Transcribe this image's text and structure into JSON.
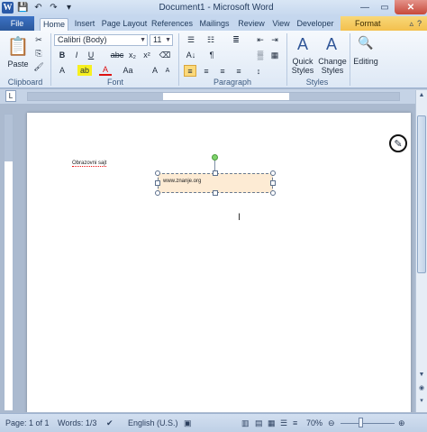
{
  "window": {
    "title": "Document1 - Microsoft Word"
  },
  "tabs": [
    {
      "label": "File"
    },
    {
      "label": "Home"
    },
    {
      "label": "Insert"
    },
    {
      "label": "Page Layout"
    },
    {
      "label": "References"
    },
    {
      "label": "Mailings"
    },
    {
      "label": "Review"
    },
    {
      "label": "View"
    },
    {
      "label": "Developer"
    },
    {
      "label": "Format"
    }
  ],
  "ribbon": {
    "clipboard": {
      "paste_label": "Paste",
      "group_label": "Clipboard"
    },
    "font": {
      "font_name": "Calibri (Body)",
      "font_size": "11",
      "group_label": "Font"
    },
    "paragraph": {
      "group_label": "Paragraph"
    },
    "styles": {
      "quick_styles_label": "Quick\nStyles",
      "change_styles_label": "Change\nStyles",
      "group_label": "Styles"
    },
    "editing": {
      "label": "Editing"
    }
  },
  "document": {
    "paragraph_text": "Obrazovni sajt",
    "textbox_text": "www.znanje.org"
  },
  "statusbar": {
    "page": "Page: 1 of 1",
    "words": "Words: 1/3",
    "language": "English (U.S.)",
    "zoom": "70%"
  },
  "colors": {
    "file_tab": "#2a579a",
    "format_tab": "#f3c04d",
    "textbox_fill": "#fdebd4"
  }
}
